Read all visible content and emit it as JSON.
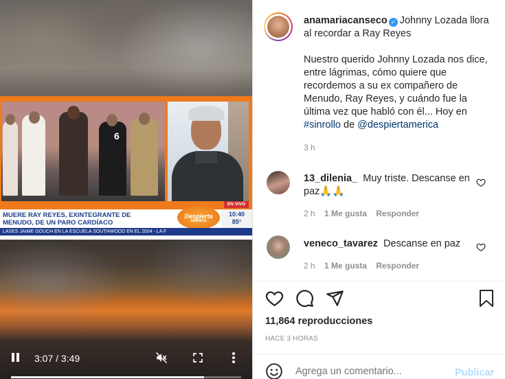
{
  "video": {
    "headline_line1": "MUERE RAY REYES, EXINTEGRANTE DE",
    "headline_line2": "MENUDO, DE UN PARO CARDÍACO",
    "ticker": "LASES   JAIME GOUCH EN LA ESCUELA SOUTHWOOD EN EL 2004 - LA F",
    "live_badge": "EN VIVO",
    "logo_text": "Despierta",
    "logo_sub": "AMÉRICA",
    "clock_time": "10:40",
    "clock_temp": "85°",
    "jersey_number": "6",
    "time_display": "3:07 / 3:49",
    "progress": 0.84,
    "icons": {
      "pause": "pause-icon",
      "mute": "volume-muted-icon",
      "fullscreen": "fullscreen-icon",
      "more": "more-vertical-icon"
    }
  },
  "post": {
    "author": "anamariacanseco",
    "caption_title": "Johnny Lozada llora al recordar a Ray Reyes",
    "caption_body": "Nuestro querido Johnny Lozada nos dice, entre lágrimas, cómo quiere que recordemos a su ex compañero de Menudo, Ray Reyes, y cuándo fue la última vez que habló con él... Hoy en",
    "hashtag": "#sinrollo",
    "caption_de": "de",
    "mention": "@despiertamerica",
    "time_ago": "3 h"
  },
  "comments": [
    {
      "user": "13_dilenia_",
      "text": "Muy triste. Descanse en paz",
      "emoji": "🙏🙏",
      "time": "2 h",
      "likes": "1 Me gusta",
      "reply": "Responder"
    },
    {
      "user": "veneco_tavarez",
      "text": "Descanse en paz",
      "emoji": "",
      "time": "2 h",
      "likes": "1 Me gusta",
      "reply": "Responder"
    }
  ],
  "stats": {
    "views": "11,864 reproducciones",
    "posted": "HACE 3 HORAS"
  },
  "composer": {
    "placeholder": "Agrega un comentario...",
    "publish": "Publicar"
  }
}
